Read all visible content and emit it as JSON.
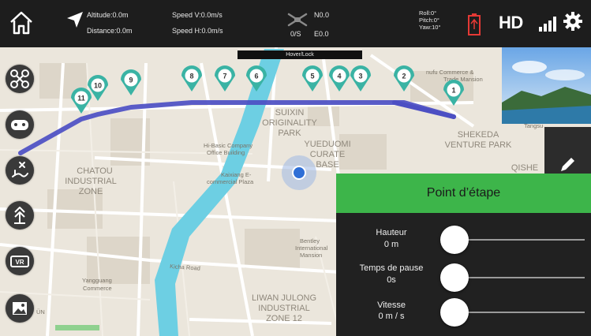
{
  "telemetry": {
    "altitude": "Altitude:0.0m",
    "distance": "Distance:0.0m",
    "speed_v": "Speed V:0.0m/s",
    "speed_h": "Speed H:0.0m/s",
    "n_coord": "N0.0",
    "gps_status": "0/S",
    "e_coord": "E0.0",
    "roll": "Roll:0°",
    "pitch": "Pitch:0°",
    "yaw": "Yaw:10°",
    "hd": "HD"
  },
  "mode_banner": "Hover/Lock",
  "map": {
    "labels": [
      "SUIXIN",
      "ORIGINALITY",
      "PARK",
      "YUEDUOMI",
      "CURATE",
      "BASE",
      "SHEKEDA",
      "VENTURE PARK",
      "CHATOU",
      "INDUSTRIAL",
      "ZONE",
      "LIWAN JULONG",
      "INDUSTRIAL",
      "ZONE 12",
      "QISHE",
      "Kicha Road",
      "Yangguang",
      "Commerce",
      "Bentley",
      "International",
      "Mansion",
      "Hi-Basic Company",
      "Office Building",
      "Kaixiang E-",
      "commercial Plaza",
      "nufu Commerce &",
      "Trade Mansion",
      "Tangsu",
      "ÜN"
    ],
    "waypoints": [
      "1",
      "2",
      "3",
      "4",
      "5",
      "6",
      "7",
      "8",
      "9",
      "10",
      "11"
    ]
  },
  "panel": {
    "title": "Point d’étape",
    "rows": [
      {
        "label": "Hauteur",
        "value": "0 m",
        "level": 0
      },
      {
        "label": "Temps de pause",
        "value": "0s",
        "level": 0
      },
      {
        "label": "Vitesse",
        "value": "0 m / s",
        "level": 0
      }
    ]
  },
  "icons": {
    "home": "home-icon",
    "navigation": "navigation-arrow-icon",
    "drone": "drone-icon",
    "battery": "battery-icon",
    "signal": "signal-bars-icon",
    "settings": "gear-icon",
    "edit": "pencil-icon",
    "left_buttons": [
      "drone-quad-icon",
      "gamepad-icon",
      "waypoint-mode-icon",
      "altitude-hold-icon",
      "vr-icon",
      "gallery-icon"
    ]
  },
  "colors": {
    "route": "#4c4fc3",
    "waypoint": "#3ab3a4",
    "panel_header": "#3db54a",
    "river": "#6dcfe3",
    "battery": "#e53935"
  }
}
